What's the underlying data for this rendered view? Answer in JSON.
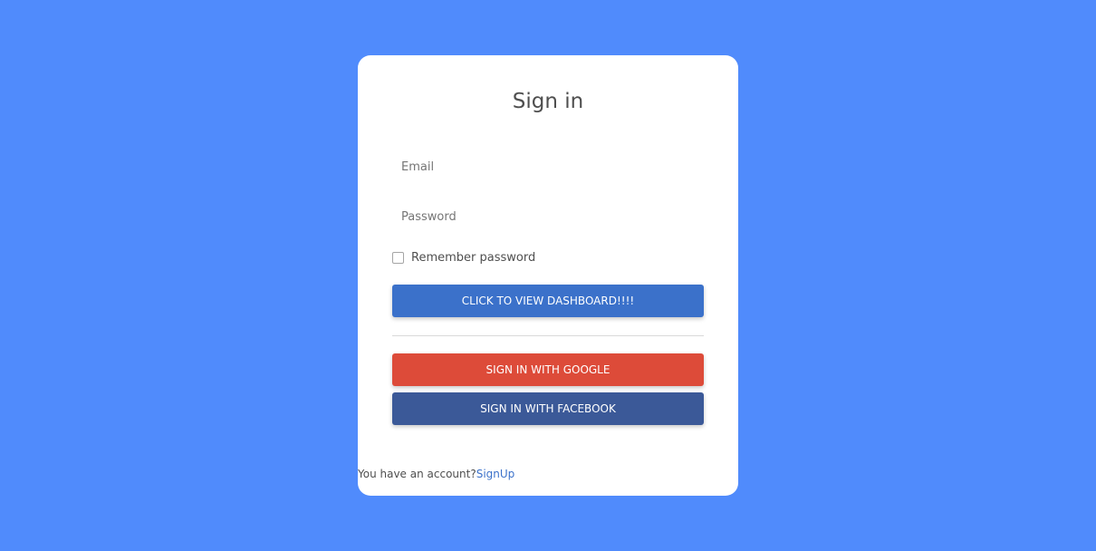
{
  "colors": {
    "page_background": "#508bfc",
    "card_background": "#ffffff",
    "primary_button": "#3b71ca",
    "google_button": "#dd4b39",
    "facebook_button": "#3b5998",
    "link": "#3b71ca"
  },
  "form": {
    "title": "Sign in",
    "email_placeholder": "Email",
    "password_placeholder": "Password",
    "remember_label": "Remember password",
    "remember_checked": false,
    "dashboard_button": "CLICK TO VIEW DASHBOARD!!!!",
    "google_button": "SIGN IN WITH GOOGLE",
    "facebook_button": "SIGN IN WITH FACEBOOK"
  },
  "footer": {
    "account_text": "You have an account?",
    "signup_link": "SignUp"
  }
}
